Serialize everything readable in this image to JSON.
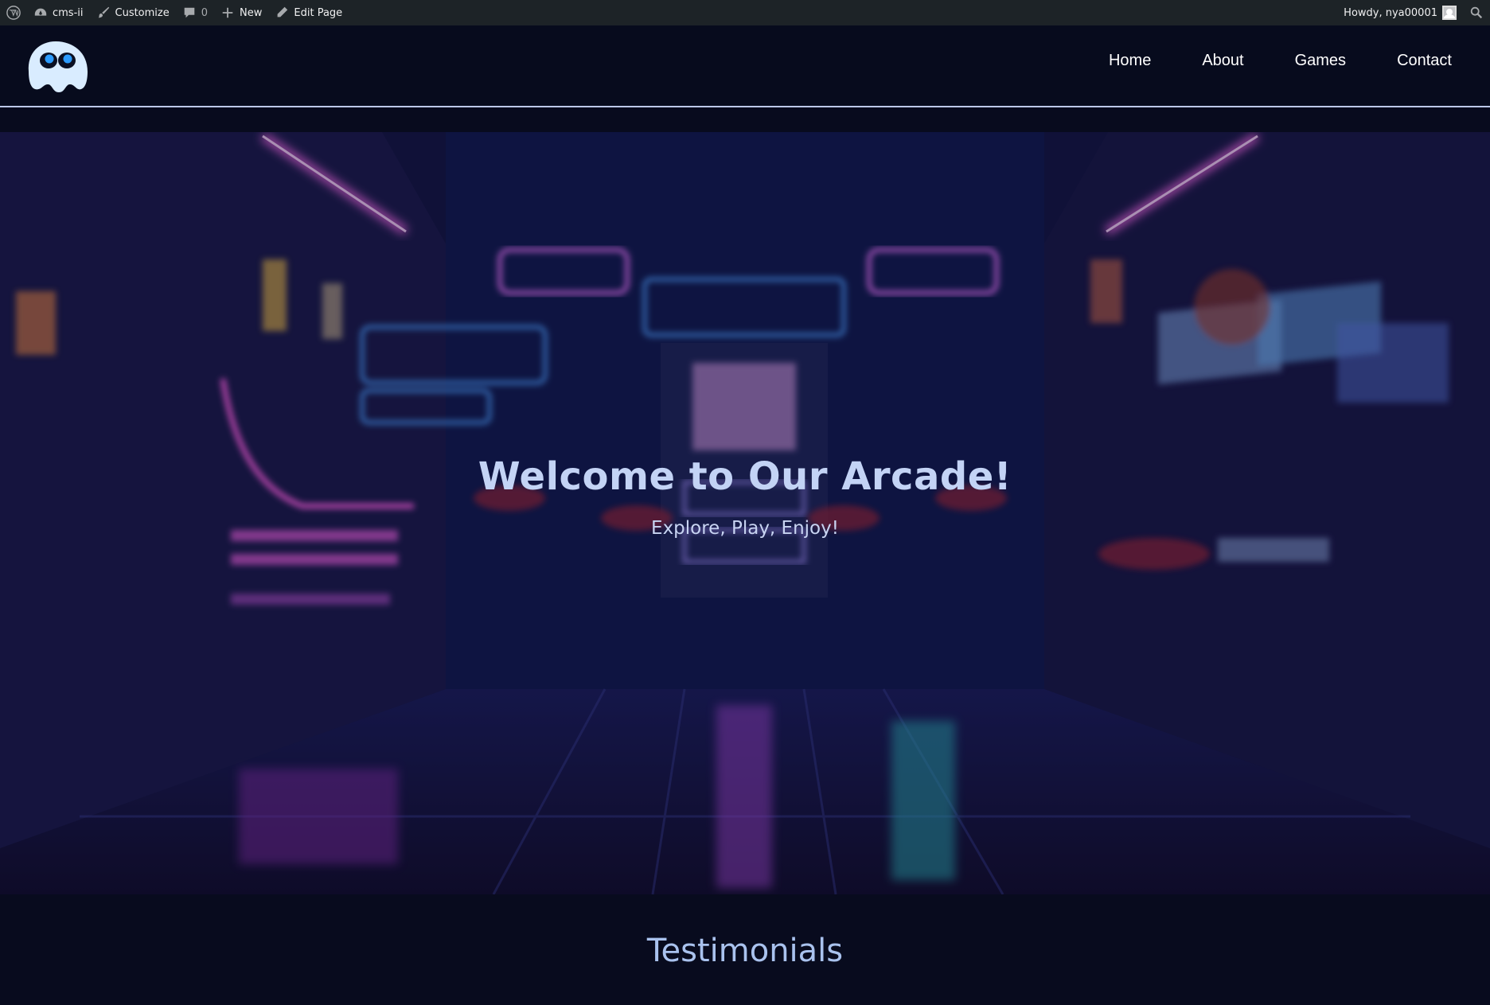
{
  "admin_bar": {
    "site_name": "cms-ii",
    "customize": "Customize",
    "comments_count": "0",
    "new": "New",
    "edit_page": "Edit Page",
    "greeting": "Howdy, nya00001"
  },
  "header": {
    "nav": [
      "Home",
      "About",
      "Games",
      "Contact"
    ]
  },
  "hero": {
    "title": "Welcome to Our Arcade!",
    "subtitle": "Explore, Play, Enjoy!"
  },
  "testimonials": {
    "heading": "Testimonials"
  },
  "colors": {
    "admin_bar_bg": "#1d2327",
    "page_bg": "#080b1e",
    "hero_title": "#c3d3f5",
    "heading": "#a9c2ee"
  }
}
